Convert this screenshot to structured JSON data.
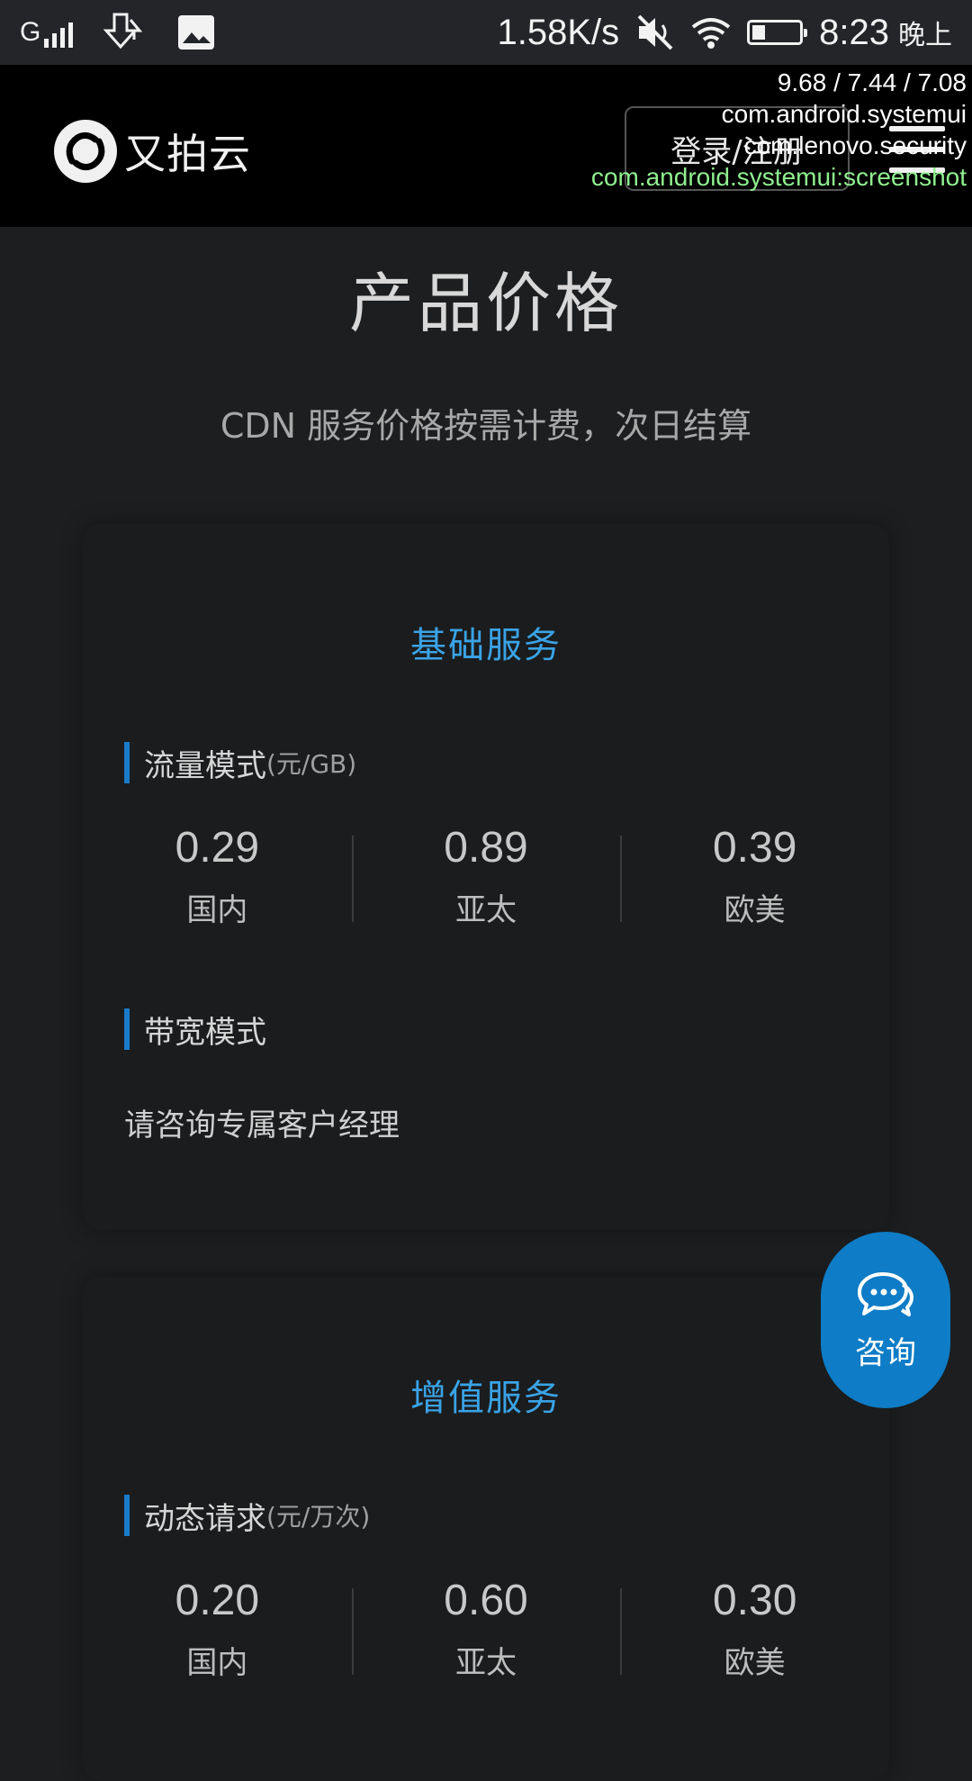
{
  "status_bar": {
    "signal_label": "G",
    "network_speed": "1.58K/s",
    "time": "8:23",
    "ampm": "晚上",
    "icons": [
      "signal-icon",
      "download-icon",
      "image-icon",
      "mute-icon",
      "wifi-icon",
      "battery-icon"
    ],
    "battery_level": 0.2
  },
  "debug_overlay": {
    "line1": "9.68 / 7.44 / 7.08",
    "line2": "com.android.systemui",
    "line3": "com.lenovo.security",
    "line4": "com.android.systemui:screenshot"
  },
  "header": {
    "logo_text": "又拍云",
    "login_label": "登录/注册"
  },
  "page": {
    "title": "产品价格",
    "subtitle": "CDN 服务价格按需计费，次日结算"
  },
  "basic_service": {
    "title": "基础服务",
    "traffic_label": "流量模式",
    "traffic_unit": "(元/GB)",
    "traffic_prices": [
      {
        "value": "0.29",
        "region": "国内"
      },
      {
        "value": "0.89",
        "region": "亚太"
      },
      {
        "value": "0.39",
        "region": "欧美"
      }
    ],
    "bandwidth_label": "带宽模式",
    "bandwidth_note": "请咨询专属客户经理"
  },
  "value_added_service": {
    "title": "增值服务",
    "dynamic_label": "动态请求",
    "dynamic_unit": "(元/万次)",
    "dynamic_prices": [
      {
        "value": "0.20",
        "region": "国内"
      },
      {
        "value": "0.60",
        "region": "亚太"
      },
      {
        "value": "0.30",
        "region": "欧美"
      }
    ]
  },
  "consult_button": {
    "label": "咨询"
  },
  "colors": {
    "accent_blue": "#3aa3e6",
    "section_bar_blue": "#1a7bc9",
    "consult_blue": "#0e7cc6",
    "background": "#1c1e20"
  }
}
